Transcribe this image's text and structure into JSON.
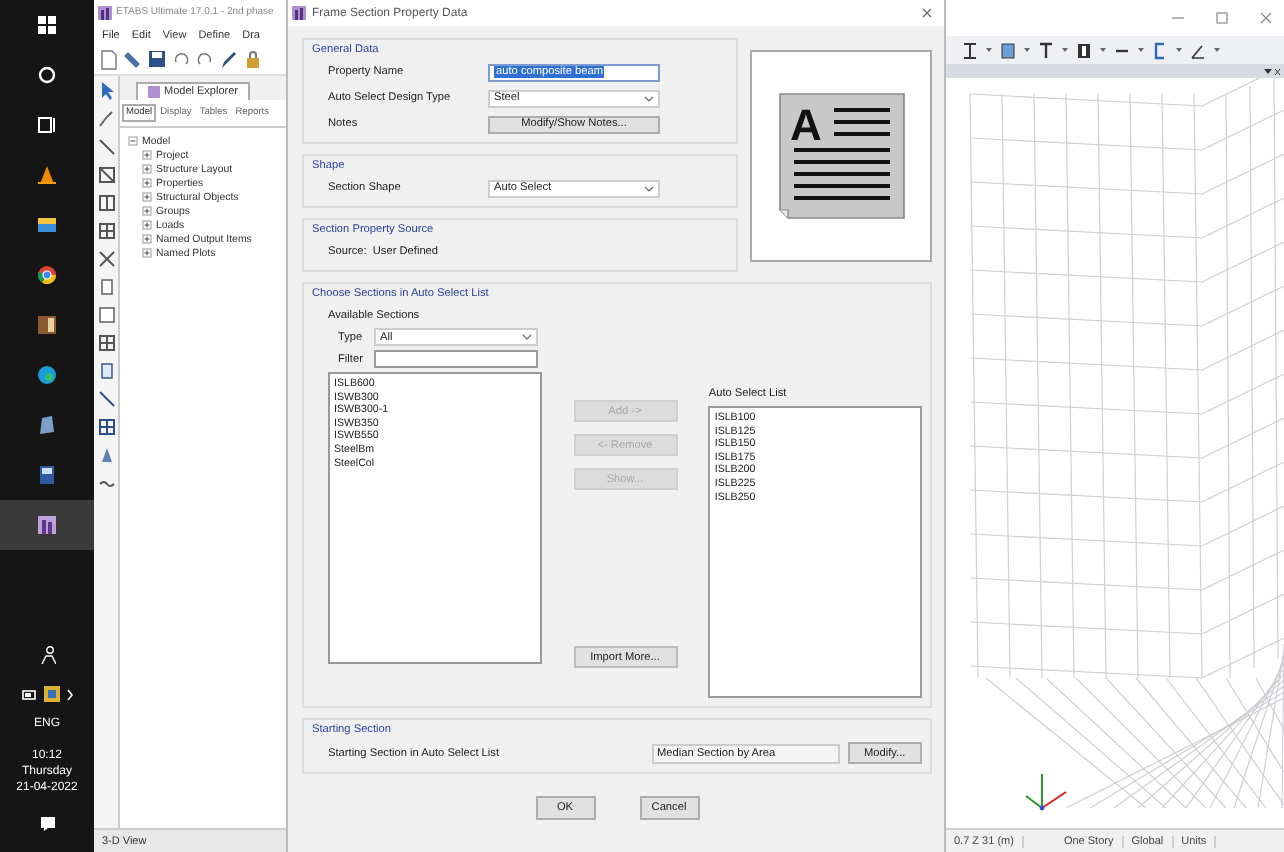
{
  "taskbar": {
    "language": "ENG",
    "time": "10:12",
    "day": "Thursday",
    "date": "21-04-2022"
  },
  "app": {
    "title": "ETABS Ultimate 17.0.1 - 2nd phase",
    "menu": [
      "File",
      "Edit",
      "View",
      "Define",
      "Dra"
    ],
    "explorer_title": "Model Explorer",
    "explorer_tabs": [
      {
        "label": "Model",
        "selected": true
      },
      {
        "label": "Display",
        "selected": false
      },
      {
        "label": "Tables",
        "selected": false
      },
      {
        "label": "Reports",
        "selected": false
      }
    ],
    "tree": [
      {
        "label": "Model",
        "expanded": true,
        "children": [
          {
            "label": "Project",
            "expanded": false
          },
          {
            "label": "Structure Layout",
            "expanded": false
          },
          {
            "label": "Properties",
            "expanded": false
          },
          {
            "label": "Structural Objects",
            "expanded": false
          },
          {
            "label": "Groups",
            "expanded": false
          },
          {
            "label": "Loads",
            "expanded": false
          },
          {
            "label": "Named Output Items",
            "expanded": false
          },
          {
            "label": "Named Plots",
            "expanded": false
          }
        ]
      }
    ],
    "view_name": "3-D View",
    "status_bar": [
      "0.7 Z 31 (m)",
      "One Story",
      "Global",
      "Units"
    ]
  },
  "dialog": {
    "title": "Frame Section Property Data",
    "general_data": {
      "title": "General Data",
      "property_name_label": "Property Name",
      "property_name": "auto composite beam",
      "design_type_label": "Auto Select Design Type",
      "design_type": "Steel",
      "notes_label": "Notes",
      "notes_button": "Modify/Show Notes..."
    },
    "preview": {
      "glyph": "A"
    },
    "shape": {
      "title": "Shape",
      "label": "Section Shape",
      "value": "Auto Select"
    },
    "source": {
      "title": "Section Property Source",
      "text": "Source:  User Defined"
    },
    "choose": {
      "title": "Choose Sections in Auto Select List",
      "available_title": "Available Sections",
      "type_label": "Type",
      "type_value": "All",
      "filter_label": "Filter",
      "available": [
        "ISLB600",
        "ISWB300",
        "ISWB300-1",
        "ISWB350",
        "ISWB550",
        "SteelBm",
        "SteelCol"
      ],
      "buttons": [
        {
          "label": "Add ->",
          "disabled": true
        },
        {
          "label": "<- Remove",
          "disabled": true
        },
        {
          "label": "Show...",
          "disabled": true
        }
      ],
      "import_button": "Import More...",
      "auto_title": "Auto Select List",
      "auto_list": [
        "ISLB100",
        "ISLB125",
        "ISLB150",
        "ISLB175",
        "ISLB200",
        "ISLB225",
        "ISLB250"
      ]
    },
    "starting": {
      "title": "Starting Section",
      "label": "Starting Section in Auto Select List",
      "value": "Median Section by Area",
      "button": "Modify..."
    },
    "buttons": [
      "OK",
      "Cancel"
    ]
  }
}
